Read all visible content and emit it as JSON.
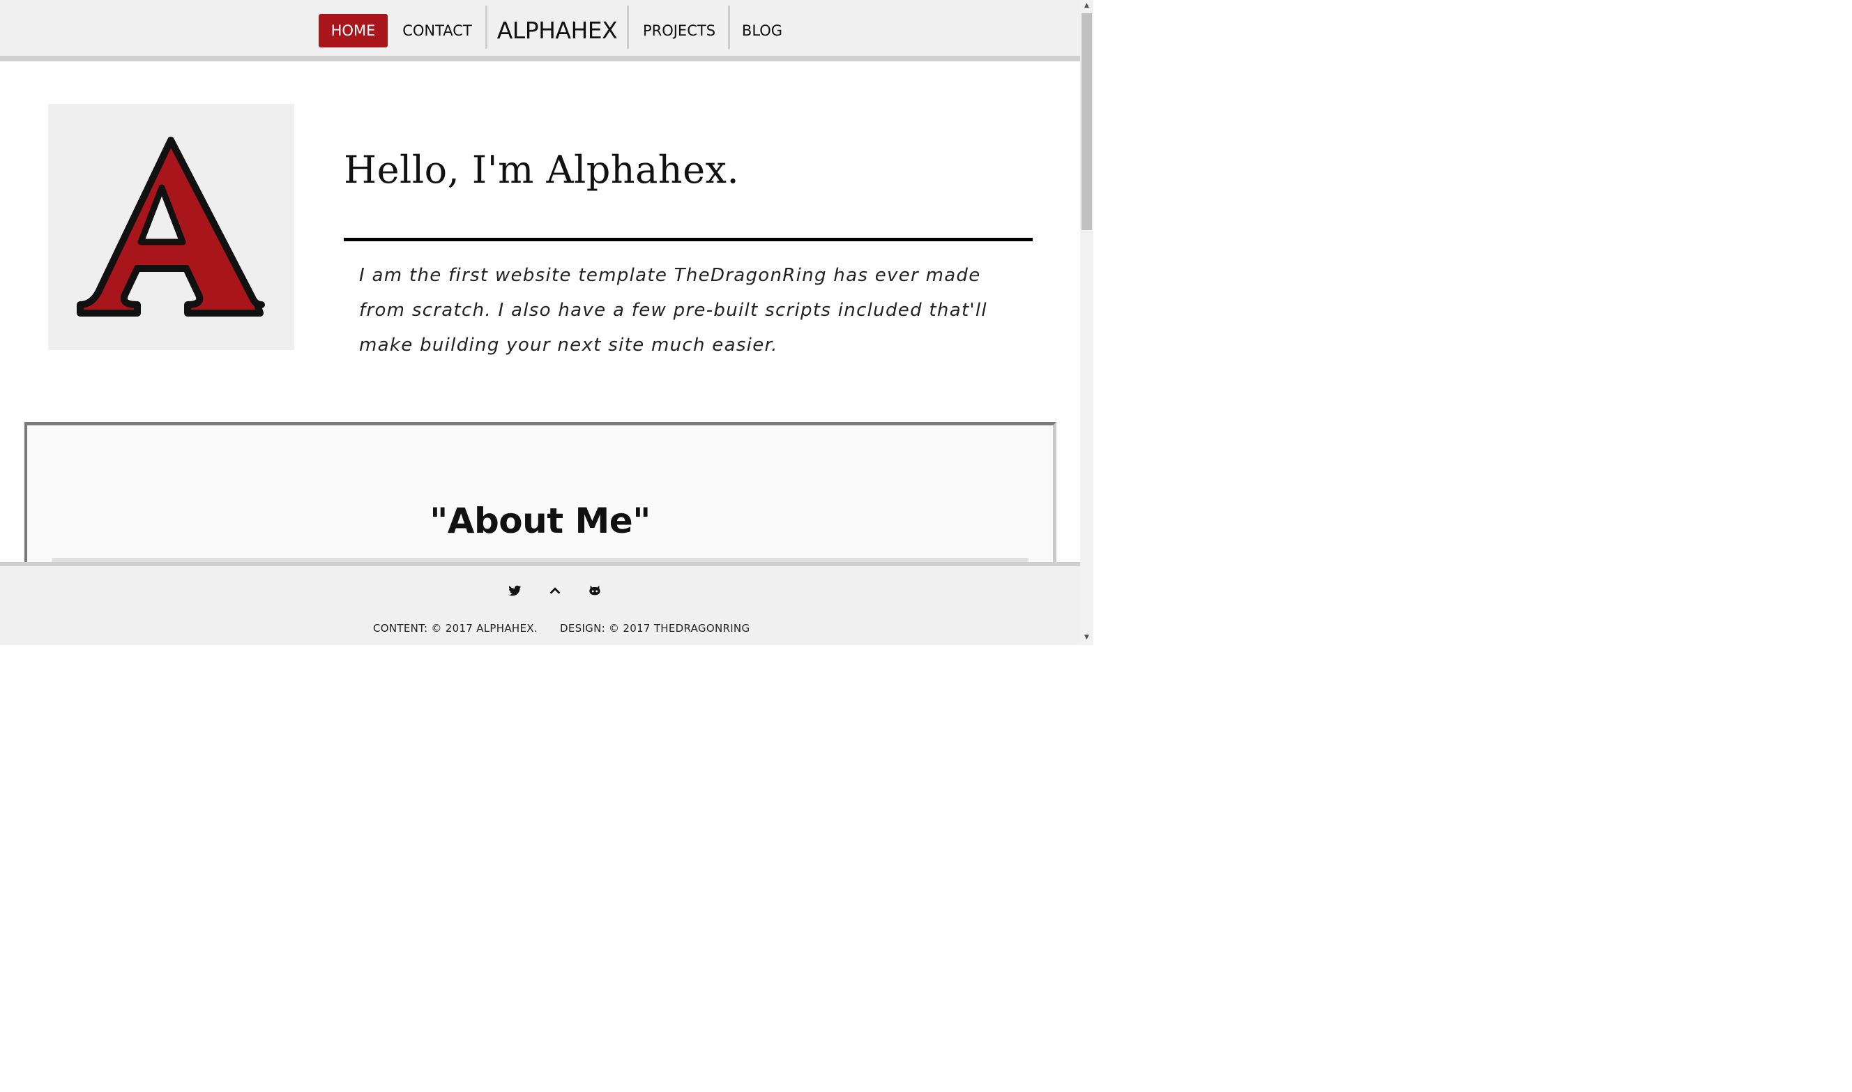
{
  "nav": {
    "home": "HOME",
    "contact": "CONTACT",
    "brand": "ALPHAHEX",
    "projects": "PROJECTS",
    "blog": "BLOG"
  },
  "hero": {
    "logo_letter": "A",
    "title": "Hello, I'm Alphahex.",
    "intro": "I am the first website template TheDragonRing has ever made from scratch. I also have a few pre-built scripts included that'll make building your next site much easier."
  },
  "about": {
    "title": "\"About Me\""
  },
  "footer": {
    "icons": [
      "twitter-icon",
      "chevron-up-icon",
      "github-icon"
    ],
    "content_copyright": "CONTENT: © 2017 ALPHAHEX.",
    "design_copyright": "DESIGN: © 2017 THEDRAGONRING"
  },
  "colors": {
    "accent": "#a8161c",
    "nav_bg": "#f0f0f0",
    "logo_bg": "#efefef"
  }
}
